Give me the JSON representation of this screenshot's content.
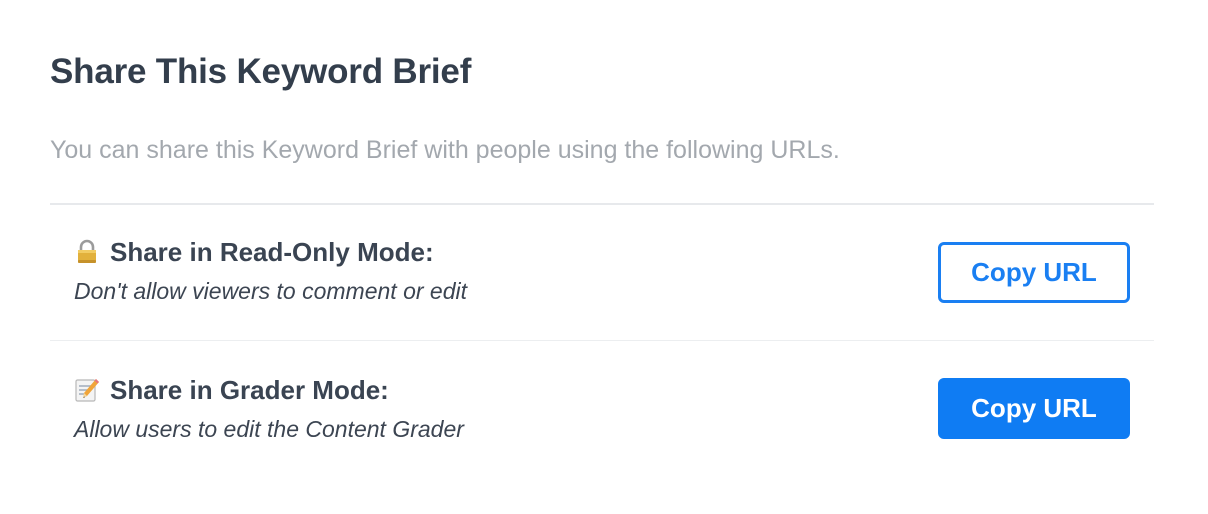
{
  "modal": {
    "title": "Share This Keyword Brief",
    "subtitle": "You can share this Keyword Brief with people using the following URLs."
  },
  "options": [
    {
      "icon": "lock-icon",
      "label": "Share in Read-Only Mode:",
      "description": "Don't allow viewers to comment or edit",
      "button_label": "Copy URL",
      "button_style": "outline"
    },
    {
      "icon": "memo-pencil-icon",
      "label": "Share in Grader Mode:",
      "description": "Allow users to edit the Content Grader",
      "button_label": "Copy URL",
      "button_style": "solid"
    }
  ],
  "colors": {
    "accent": "#1a7ff2",
    "title": "#333e4c",
    "muted": "#a3a8ae",
    "divider": "#e7e9ec"
  }
}
